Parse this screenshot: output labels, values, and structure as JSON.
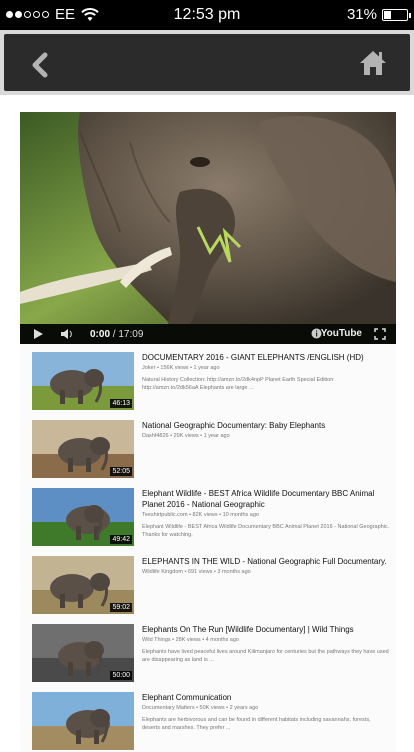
{
  "status": {
    "carrier": "EE",
    "time": "12:53 pm",
    "battery": "31%",
    "battery_level": 0.31
  },
  "nav": {
    "back": "back-icon",
    "home": "home-icon"
  },
  "player": {
    "current_time": "0:00",
    "separator": " / ",
    "duration": "17:09",
    "brand": "YouTube"
  },
  "videos": [
    {
      "title": "DOCUMENTARY 2016 - GIANT ELEPHANTS /ENGLISH (HD)",
      "meta": "Joker • 156K views • 1 year ago",
      "desc": "Natural History Collection: http://amzn.to/2dk4npP Planet Earth Special Edition: http://amzn.to/2dk56aA Elephants are large ...",
      "duration": "46:13",
      "sky": "#87b4d8",
      "ground": "#7a9a3c"
    },
    {
      "title": "National Geographic Documentary: Baby Elephants",
      "meta": "Dashf4826 • 29K views • 1 year ago",
      "desc": "",
      "duration": "52:05",
      "sky": "#c9b79a",
      "ground": "#8a6b4a"
    },
    {
      "title": "Elephant Wildlife - BEST Africa Wildlife Documentary BBC Animal Planet 2016 - National Geographic",
      "meta": "Teeshirtpublic.com • 82K views • 10 months ago",
      "desc": "Elephant Wildlife - BEST Africa Wildlife Documentary BBC Animal Planet 2016 - National Geographic. Thanks for watching.",
      "duration": "49:42",
      "sky": "#5d8fc4",
      "ground": "#3f7a2b"
    },
    {
      "title": "ELEPHANTS IN THE WILD - National Geographic Full Documentary.",
      "meta": "Wildlife Kingdom • 691 views • 3 months ago",
      "desc": "",
      "duration": "59:02",
      "sky": "#c2b493",
      "ground": "#9c8a5e"
    },
    {
      "title": "Elephants On The Run [Wildlife Documentary] | Wild Things",
      "meta": "Wild Things • 28K views • 4 months ago",
      "desc": "Elephants have lived peaceful lives around Kilimanjaro for centuries but the pathways they have used are disappearing as land is ...",
      "duration": "50:00",
      "sky": "#6f6f6f",
      "ground": "#4a4a4a"
    },
    {
      "title": "Elephant Communication",
      "meta": "Documentary Matters • 50K views • 2 years ago",
      "desc": "Elephants are herbivorous and can be found in different habitats including savannahs, forests, deserts and marshes. They prefer ...",
      "duration": "",
      "sky": "#7fb0d9",
      "ground": "#a48c62"
    }
  ],
  "colors": {
    "nav_bg": "#2b2b2b",
    "nav_icon": "#b3b3b3",
    "status_bg": "#000000"
  }
}
